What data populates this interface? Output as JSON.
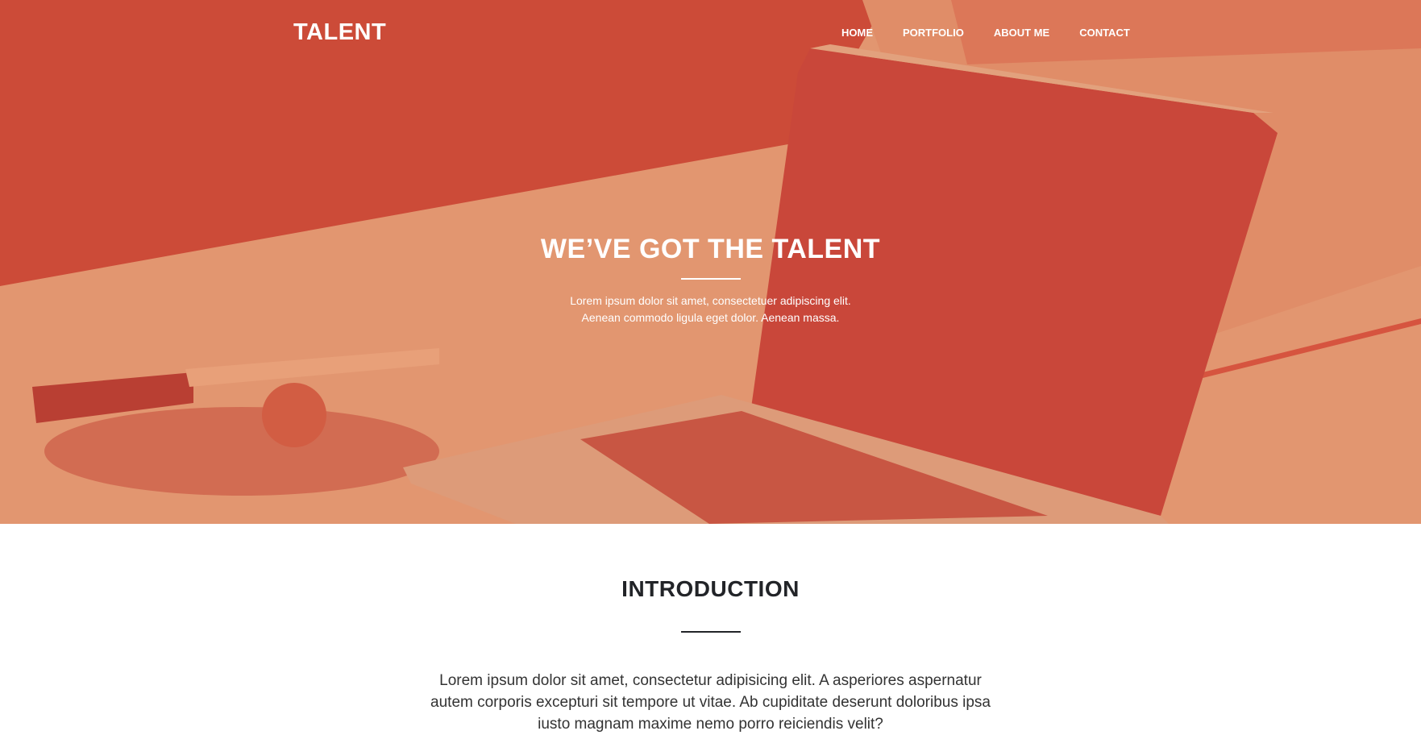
{
  "nav": {
    "brand": "TALENT",
    "items": [
      {
        "label": "HOME"
      },
      {
        "label": "PORTFOLIO"
      },
      {
        "label": "ABOUT ME"
      },
      {
        "label": "CONTACT"
      }
    ]
  },
  "hero": {
    "title": "WE’VE GOT THE TALENT",
    "subtitle_line1": "Lorem ipsum dolor sit amet, consectetuer adipiscing elit.",
    "subtitle_line2": "Aenean commodo ligula eget dolor. Aenean massa.",
    "overlay_color": "#d9533c"
  },
  "intro": {
    "title": "INTRODUCTION",
    "body": "Lorem ipsum dolor sit amet, consectetur adipisicing elit. A asperiores aspernatur autem corporis excepturi sit tempore ut vitae. Ab cupiditate deserunt doloribus ipsa iusto magnam maxime nemo porro reiciendis velit?"
  }
}
